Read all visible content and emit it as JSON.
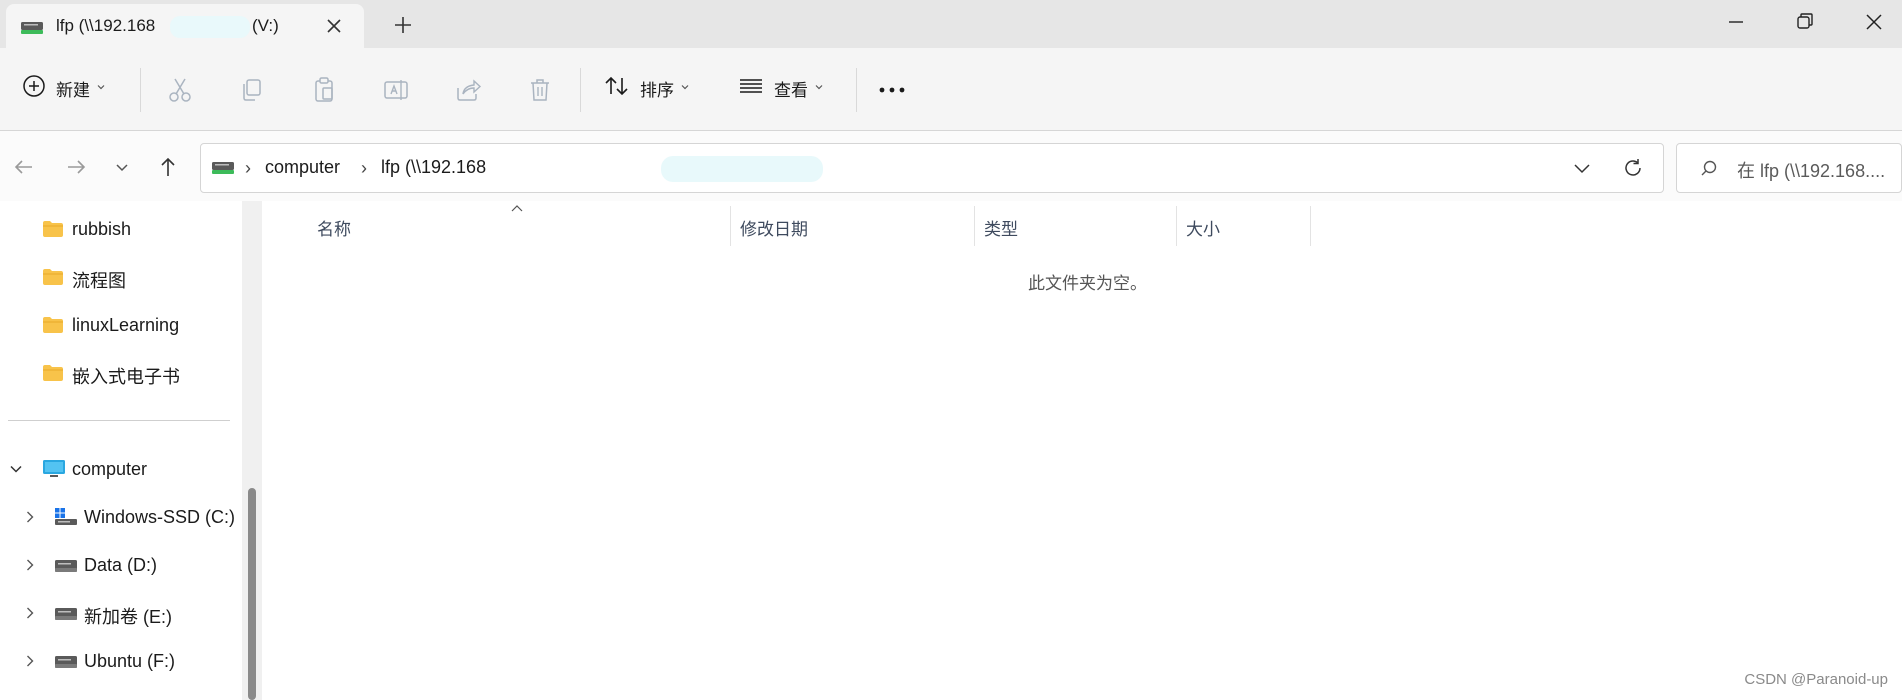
{
  "tab": {
    "title": "lfp (\\\\192.168",
    "title_suffix": "(V:)",
    "icon": "network-drive-icon"
  },
  "window_controls": {
    "minimize": "minimize-icon",
    "maximize": "restore-icon",
    "close": "close-icon"
  },
  "toolbar": {
    "new_label": "新建",
    "sort_label": "排序",
    "view_label": "查看",
    "actions": [
      "cut-icon",
      "copy-icon",
      "paste-icon",
      "rename-icon",
      "share-icon",
      "delete-icon"
    ]
  },
  "address": {
    "root_label": "computer",
    "current_label": "lfp (\\\\192.168",
    "current_suffix": ")"
  },
  "search": {
    "placeholder": "在 lfp (\\\\192.168...."
  },
  "sidebar": {
    "folders": [
      {
        "label": "rubbish"
      },
      {
        "label": "流程图"
      },
      {
        "label": "linuxLearning"
      },
      {
        "label": "嵌入式电子书"
      }
    ],
    "computer_label": "computer",
    "drives": [
      {
        "label": "Windows-SSD (C:)"
      },
      {
        "label": "Data (D:)"
      },
      {
        "label": "新加卷 (E:)"
      },
      {
        "label": "Ubuntu (F:)"
      }
    ]
  },
  "columns": {
    "name": "名称",
    "modified": "修改日期",
    "type": "类型",
    "size": "大小"
  },
  "empty_message": "此文件夹为空。",
  "watermark": "CSDN @Paranoid-up",
  "colors": {
    "folder": "#f8c34a",
    "accent": "#1a73e8",
    "drive_green": "#3dbb5a"
  }
}
